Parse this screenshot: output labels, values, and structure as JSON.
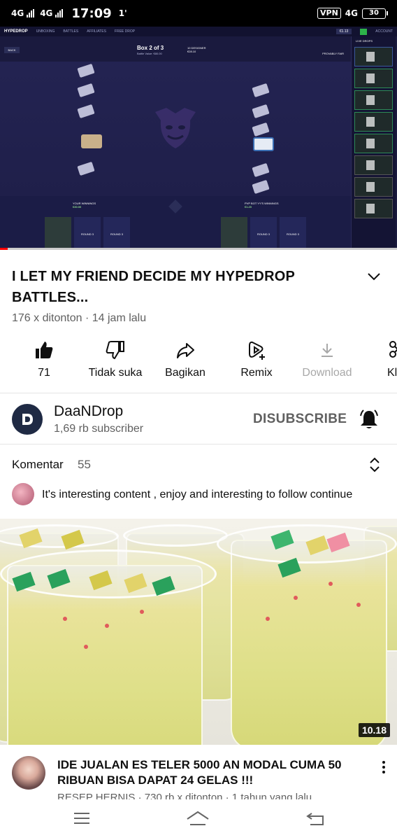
{
  "status_bar": {
    "net1": "4G",
    "net2": "4G",
    "time": "17:09",
    "extra": "1'",
    "vpn": "VPN",
    "net3": "4G",
    "battery": "30"
  },
  "player": {
    "site_logo": "HYPEDROP",
    "nav_items": [
      "UNBOXING",
      "BATTLES",
      "AFFILIATES",
      "FREE DROP"
    ],
    "balance": "€1.13",
    "account": "ACCOUNT",
    "back": "BACK",
    "box_title": "Box 2 of 3",
    "box_sub": "Battle Value: €80.00",
    "designer": "10 DESIGNER",
    "designer_price": "€28.10",
    "provably_fair": "PROVABLY FAIR",
    "live_drops": "LIVE DROPS",
    "your_winnings": "YOUR WINNINGS",
    "your_winnings_value": "€30.00",
    "opponent_winnings": "PVP BOT YY'S WINNINGS",
    "opponent_winnings_value": "€1.20",
    "round_label": "ROUND 3",
    "progress": 0.02
  },
  "video": {
    "title": "I LET MY FRIEND DECIDE MY HYPEDROP BATTLES...",
    "meta": "176 x ditonton · 14 jam lalu"
  },
  "actions": [
    {
      "label": "71",
      "icon": "thumbs-up-filled-icon"
    },
    {
      "label": "Tidak suka",
      "icon": "thumbs-down-icon"
    },
    {
      "label": "Bagikan",
      "icon": "share-icon"
    },
    {
      "label": "Remix",
      "icon": "remix-icon"
    },
    {
      "label": "Download",
      "icon": "download-icon"
    },
    {
      "label": "Kl",
      "icon": "clip-icon"
    }
  ],
  "channel": {
    "name": "DaaNDrop",
    "subscribers": "1,69 rb subscriber",
    "unsubscribe": "DISUBSCRIBE",
    "avatar_letter": "D"
  },
  "comments": {
    "label": "Komentar",
    "count": "55",
    "top_comment": "It's interesting content , enjoy and  interesting to follow continue"
  },
  "next_video": {
    "duration": "10.18",
    "title": "IDE JUALAN ES TELER 5000 AN MODAL CUMA 50 RIBUAN BISA DAPAT 24 GELAS !!!",
    "meta": "RESEP HERNIS · 730 rb x ditonton · 1 tahun yang lalu"
  },
  "colors": {
    "accent_red": "#ff0000",
    "text_primary": "#0f0f0f",
    "text_secondary": "#606060"
  }
}
